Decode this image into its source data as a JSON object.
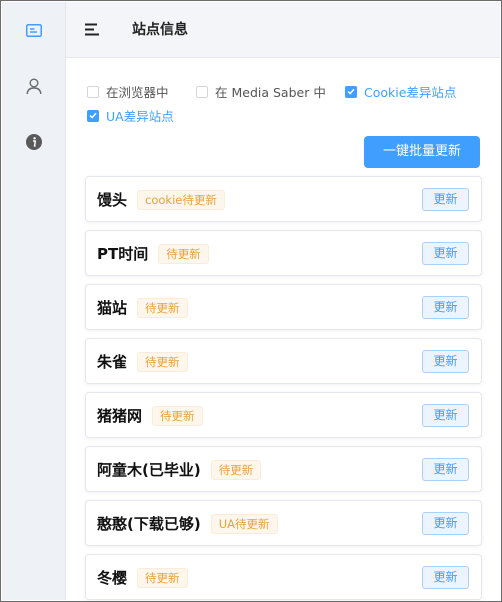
{
  "header": {
    "title": "站点信息"
  },
  "sidebar": {
    "items": [
      {
        "icon": "id-card-icon",
        "active": true
      },
      {
        "icon": "user-icon",
        "active": false
      },
      {
        "icon": "info-icon",
        "active": false
      }
    ]
  },
  "filters": [
    {
      "label": "在浏览器中",
      "checked": false
    },
    {
      "label": "在 Media Saber 中",
      "checked": false
    },
    {
      "label": "Cookie差异站点",
      "checked": true
    },
    {
      "label": "UA差异站点",
      "checked": true
    }
  ],
  "batch_button": "一键批量更新",
  "sites": [
    {
      "name": "馒头",
      "tag": "cookie待更新",
      "button": "更新"
    },
    {
      "name": "PT时间",
      "tag": "待更新",
      "button": "更新"
    },
    {
      "name": "猫站",
      "tag": "待更新",
      "button": "更新"
    },
    {
      "name": "朱雀",
      "tag": "待更新",
      "button": "更新"
    },
    {
      "name": "猪猪网",
      "tag": "待更新",
      "button": "更新"
    },
    {
      "name": "阿童木(已毕业)",
      "tag": "待更新",
      "button": "更新"
    },
    {
      "name": "憨憨(下载已够)",
      "tag": "UA待更新",
      "button": "更新"
    },
    {
      "name": "冬樱",
      "tag": "待更新",
      "button": "更新"
    }
  ],
  "colors": {
    "primary": "#409eff",
    "warning": "#e6a23c",
    "sidebar_bg": "#eef1f6"
  }
}
